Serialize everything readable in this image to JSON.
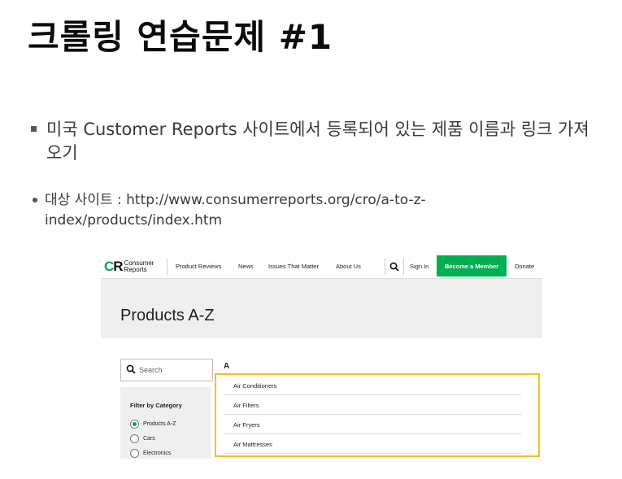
{
  "slide": {
    "title": "크롤링 연습문제 #1",
    "bullet1": "미국 Customer Reports 사이트에서 등록되어 있는 제품 이름과 링크 가져오기",
    "bullet2": "대상 사이트 : http://www.consumerreports.org/cro/a-to-z-index/products/index.htm"
  },
  "site": {
    "logo": {
      "mark_c": "C",
      "mark_r": "R",
      "line1": "Consumer",
      "line2": "Reports"
    },
    "nav": [
      "Product Reviews",
      "News",
      "Issues That Matter",
      "About Us"
    ],
    "sign_in": "Sign In",
    "member_button": "Become a Member",
    "donate": "Donate",
    "page_title": "Products A-Z",
    "search_placeholder": "Search",
    "filter_title": "Filter by Category",
    "filters": [
      {
        "label": "Products A-Z",
        "selected": true
      },
      {
        "label": "Cars",
        "selected": false
      },
      {
        "label": "Electronics",
        "selected": false
      }
    ],
    "letter": "A",
    "products": [
      "Air Conditioners",
      "Air Filters",
      "Air Fryers",
      "Air Mattresses"
    ]
  },
  "colors": {
    "brand_green": "#00b050",
    "highlight": "#f5bd1f"
  },
  "icons": {
    "search": "search-icon",
    "bullet": "square-bullet"
  }
}
